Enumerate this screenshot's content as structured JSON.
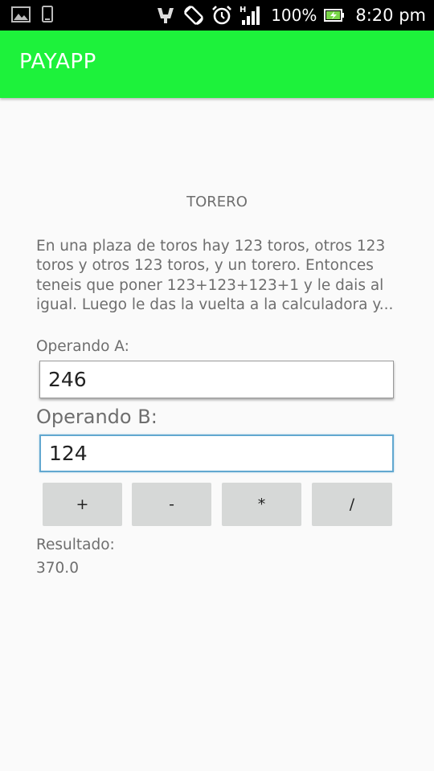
{
  "status_bar": {
    "battery_percent": "100%",
    "time": "8:20 pm",
    "network_type": "H",
    "icons": [
      "image-icon",
      "phone-icon",
      "notification-hand-icon",
      "screen-rotation-icon",
      "alarm-icon",
      "signal-icon",
      "battery-charging-icon"
    ]
  },
  "app_bar": {
    "title": "PAYAPP",
    "color": "#1df23b"
  },
  "main": {
    "heading": "TORERO",
    "description": "En una plaza de toros hay 123 toros, otros 123 toros y otros 123 toros, y un torero. Entonces teneis que poner 123+123+123+1 y le dais al igual. Luego le das la vuelta a la calculadora y...",
    "operand_a_label": "Operando A:",
    "operand_a_value": "246",
    "operand_b_label": "Operando B:",
    "operand_b_value": "124",
    "buttons": {
      "add": "+",
      "subtract": "-",
      "multiply": "*",
      "divide": "/"
    },
    "result_label": "Resultado:",
    "result_value": "370.0"
  }
}
